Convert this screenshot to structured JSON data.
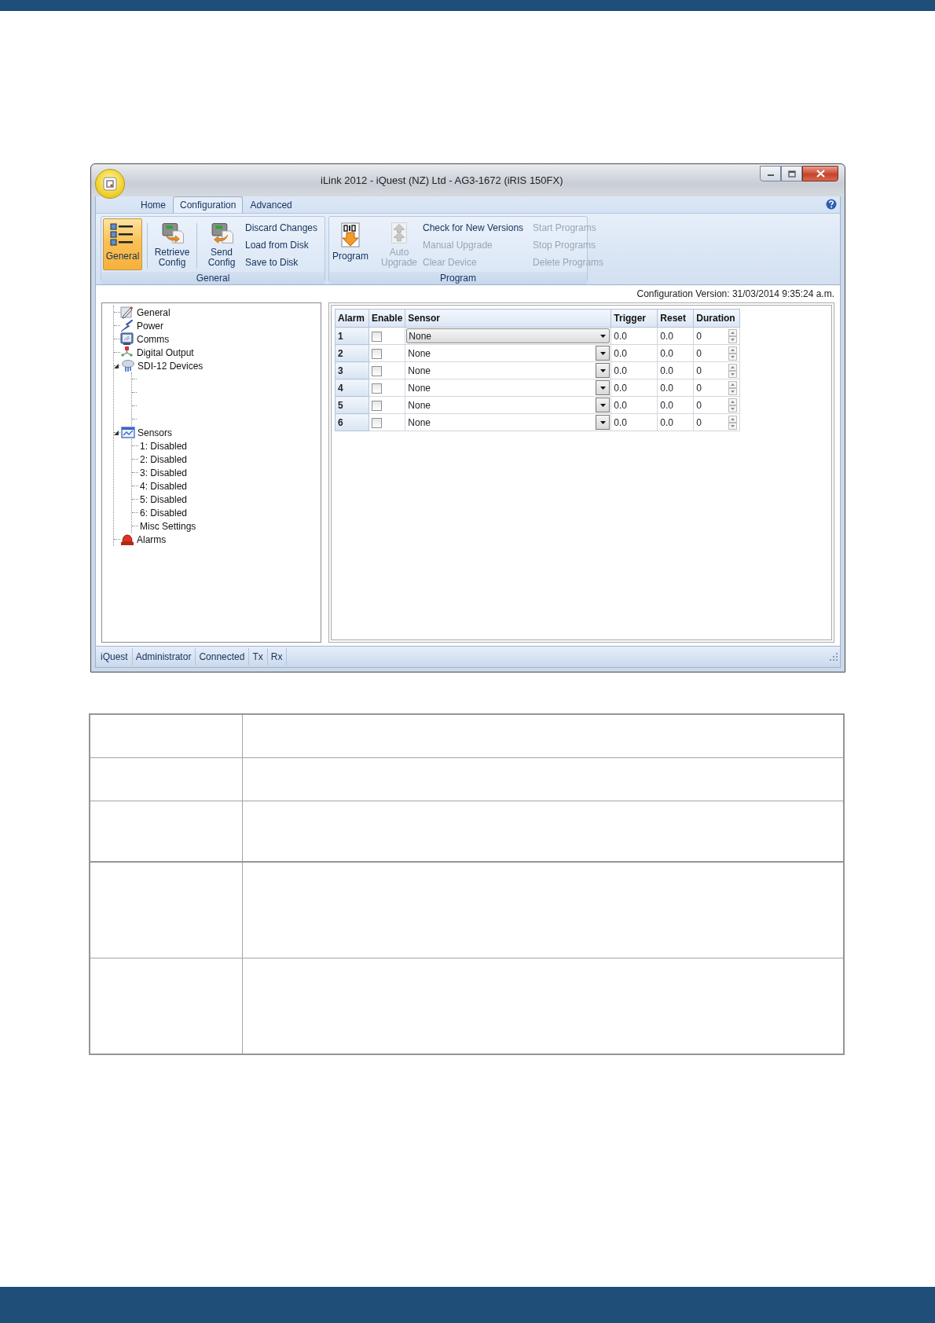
{
  "window": {
    "title": "iLink 2012 - iQuest (NZ) Ltd - AG3-1672 (iRIS 150FX)"
  },
  "ribbon": {
    "tabs": [
      {
        "label": "Home",
        "selected": false
      },
      {
        "label": "Configuration",
        "selected": true
      },
      {
        "label": "Advanced",
        "selected": false
      }
    ],
    "groups": [
      {
        "label": "General",
        "large_buttons": [
          {
            "label": "General",
            "selected": true,
            "disabled": false
          },
          {
            "label": "Retrieve Config",
            "selected": false,
            "disabled": false
          },
          {
            "label": "Send Config",
            "selected": false,
            "disabled": false
          }
        ],
        "small_buttons": [
          {
            "label": "Discard Changes",
            "disabled": false
          },
          {
            "label": "Load from Disk",
            "disabled": false
          },
          {
            "label": "Save to Disk",
            "disabled": false
          }
        ]
      },
      {
        "label": "Program",
        "large_buttons": [
          {
            "label": "Program",
            "selected": false,
            "disabled": false
          },
          {
            "label": "Auto Upgrade",
            "selected": false,
            "disabled": true
          }
        ],
        "small_buttons": [
          {
            "label": "Check for New Versions",
            "disabled": false
          },
          {
            "label": "Manual Upgrade",
            "disabled": true
          },
          {
            "label": "Clear Device",
            "disabled": true
          },
          {
            "label": "Start Programs",
            "disabled": true
          },
          {
            "label": "Stop Programs",
            "disabled": true
          },
          {
            "label": "Delete Programs",
            "disabled": true
          }
        ]
      }
    ]
  },
  "config_version": "Configuration Version: 31/03/2014 9:35:24 a.m.",
  "tree": [
    {
      "label": "General"
    },
    {
      "label": "Power"
    },
    {
      "label": "Comms"
    },
    {
      "label": "Digital Output"
    },
    {
      "label": "SDI-12 Devices",
      "expanded": true,
      "children": [
        {
          "kind": "blank"
        },
        {
          "kind": "blank"
        },
        {
          "kind": "blank"
        },
        {
          "kind": "blank"
        }
      ]
    },
    {
      "label": "Sensors",
      "expanded": true,
      "children": [
        {
          "label": "1: Disabled"
        },
        {
          "label": "2: Disabled"
        },
        {
          "label": "3: Disabled"
        },
        {
          "label": "4: Disabled"
        },
        {
          "label": "5: Disabled"
        },
        {
          "label": "6: Disabled"
        },
        {
          "label": "Misc Settings"
        }
      ]
    },
    {
      "label": "Alarms"
    }
  ],
  "grid": {
    "columns": [
      "Alarm",
      "Enable",
      "Sensor",
      "Trigger",
      "Reset",
      "Duration"
    ],
    "rows": [
      {
        "alarm": "1",
        "enabled": false,
        "sensor": "None",
        "focused": true,
        "trigger": "0.0",
        "reset": "0.0",
        "duration": "0"
      },
      {
        "alarm": "2",
        "enabled": false,
        "sensor": "None",
        "focused": false,
        "trigger": "0.0",
        "reset": "0.0",
        "duration": "0"
      },
      {
        "alarm": "3",
        "enabled": false,
        "sensor": "None",
        "focused": false,
        "trigger": "0.0",
        "reset": "0.0",
        "duration": "0"
      },
      {
        "alarm": "4",
        "enabled": false,
        "sensor": "None",
        "focused": false,
        "trigger": "0.0",
        "reset": "0.0",
        "duration": "0"
      },
      {
        "alarm": "5",
        "enabled": false,
        "sensor": "None",
        "focused": false,
        "trigger": "0.0",
        "reset": "0.0",
        "duration": "0"
      },
      {
        "alarm": "6",
        "enabled": false,
        "sensor": "None",
        "focused": false,
        "trigger": "0.0",
        "reset": "0.0",
        "duration": "0"
      }
    ]
  },
  "status_bar": [
    "iQuest",
    "Administrator",
    "Connected",
    "Tx",
    "Rx"
  ]
}
